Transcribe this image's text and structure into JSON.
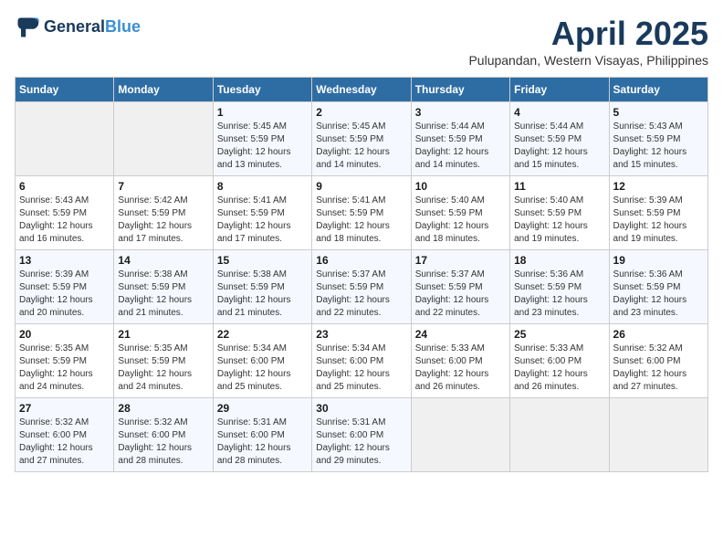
{
  "header": {
    "logo_line1": "General",
    "logo_line2": "Blue",
    "month": "April 2025",
    "location": "Pulupandan, Western Visayas, Philippines"
  },
  "weekdays": [
    "Sunday",
    "Monday",
    "Tuesday",
    "Wednesday",
    "Thursday",
    "Friday",
    "Saturday"
  ],
  "weeks": [
    [
      {
        "day": "",
        "detail": ""
      },
      {
        "day": "",
        "detail": ""
      },
      {
        "day": "1",
        "detail": "Sunrise: 5:45 AM\nSunset: 5:59 PM\nDaylight: 12 hours\nand 13 minutes."
      },
      {
        "day": "2",
        "detail": "Sunrise: 5:45 AM\nSunset: 5:59 PM\nDaylight: 12 hours\nand 14 minutes."
      },
      {
        "day": "3",
        "detail": "Sunrise: 5:44 AM\nSunset: 5:59 PM\nDaylight: 12 hours\nand 14 minutes."
      },
      {
        "day": "4",
        "detail": "Sunrise: 5:44 AM\nSunset: 5:59 PM\nDaylight: 12 hours\nand 15 minutes."
      },
      {
        "day": "5",
        "detail": "Sunrise: 5:43 AM\nSunset: 5:59 PM\nDaylight: 12 hours\nand 15 minutes."
      }
    ],
    [
      {
        "day": "6",
        "detail": "Sunrise: 5:43 AM\nSunset: 5:59 PM\nDaylight: 12 hours\nand 16 minutes."
      },
      {
        "day": "7",
        "detail": "Sunrise: 5:42 AM\nSunset: 5:59 PM\nDaylight: 12 hours\nand 17 minutes."
      },
      {
        "day": "8",
        "detail": "Sunrise: 5:41 AM\nSunset: 5:59 PM\nDaylight: 12 hours\nand 17 minutes."
      },
      {
        "day": "9",
        "detail": "Sunrise: 5:41 AM\nSunset: 5:59 PM\nDaylight: 12 hours\nand 18 minutes."
      },
      {
        "day": "10",
        "detail": "Sunrise: 5:40 AM\nSunset: 5:59 PM\nDaylight: 12 hours\nand 18 minutes."
      },
      {
        "day": "11",
        "detail": "Sunrise: 5:40 AM\nSunset: 5:59 PM\nDaylight: 12 hours\nand 19 minutes."
      },
      {
        "day": "12",
        "detail": "Sunrise: 5:39 AM\nSunset: 5:59 PM\nDaylight: 12 hours\nand 19 minutes."
      }
    ],
    [
      {
        "day": "13",
        "detail": "Sunrise: 5:39 AM\nSunset: 5:59 PM\nDaylight: 12 hours\nand 20 minutes."
      },
      {
        "day": "14",
        "detail": "Sunrise: 5:38 AM\nSunset: 5:59 PM\nDaylight: 12 hours\nand 21 minutes."
      },
      {
        "day": "15",
        "detail": "Sunrise: 5:38 AM\nSunset: 5:59 PM\nDaylight: 12 hours\nand 21 minutes."
      },
      {
        "day": "16",
        "detail": "Sunrise: 5:37 AM\nSunset: 5:59 PM\nDaylight: 12 hours\nand 22 minutes."
      },
      {
        "day": "17",
        "detail": "Sunrise: 5:37 AM\nSunset: 5:59 PM\nDaylight: 12 hours\nand 22 minutes."
      },
      {
        "day": "18",
        "detail": "Sunrise: 5:36 AM\nSunset: 5:59 PM\nDaylight: 12 hours\nand 23 minutes."
      },
      {
        "day": "19",
        "detail": "Sunrise: 5:36 AM\nSunset: 5:59 PM\nDaylight: 12 hours\nand 23 minutes."
      }
    ],
    [
      {
        "day": "20",
        "detail": "Sunrise: 5:35 AM\nSunset: 5:59 PM\nDaylight: 12 hours\nand 24 minutes."
      },
      {
        "day": "21",
        "detail": "Sunrise: 5:35 AM\nSunset: 5:59 PM\nDaylight: 12 hours\nand 24 minutes."
      },
      {
        "day": "22",
        "detail": "Sunrise: 5:34 AM\nSunset: 6:00 PM\nDaylight: 12 hours\nand 25 minutes."
      },
      {
        "day": "23",
        "detail": "Sunrise: 5:34 AM\nSunset: 6:00 PM\nDaylight: 12 hours\nand 25 minutes."
      },
      {
        "day": "24",
        "detail": "Sunrise: 5:33 AM\nSunset: 6:00 PM\nDaylight: 12 hours\nand 26 minutes."
      },
      {
        "day": "25",
        "detail": "Sunrise: 5:33 AM\nSunset: 6:00 PM\nDaylight: 12 hours\nand 26 minutes."
      },
      {
        "day": "26",
        "detail": "Sunrise: 5:32 AM\nSunset: 6:00 PM\nDaylight: 12 hours\nand 27 minutes."
      }
    ],
    [
      {
        "day": "27",
        "detail": "Sunrise: 5:32 AM\nSunset: 6:00 PM\nDaylight: 12 hours\nand 27 minutes."
      },
      {
        "day": "28",
        "detail": "Sunrise: 5:32 AM\nSunset: 6:00 PM\nDaylight: 12 hours\nand 28 minutes."
      },
      {
        "day": "29",
        "detail": "Sunrise: 5:31 AM\nSunset: 6:00 PM\nDaylight: 12 hours\nand 28 minutes."
      },
      {
        "day": "30",
        "detail": "Sunrise: 5:31 AM\nSunset: 6:00 PM\nDaylight: 12 hours\nand 29 minutes."
      },
      {
        "day": "",
        "detail": ""
      },
      {
        "day": "",
        "detail": ""
      },
      {
        "day": "",
        "detail": ""
      }
    ]
  ]
}
